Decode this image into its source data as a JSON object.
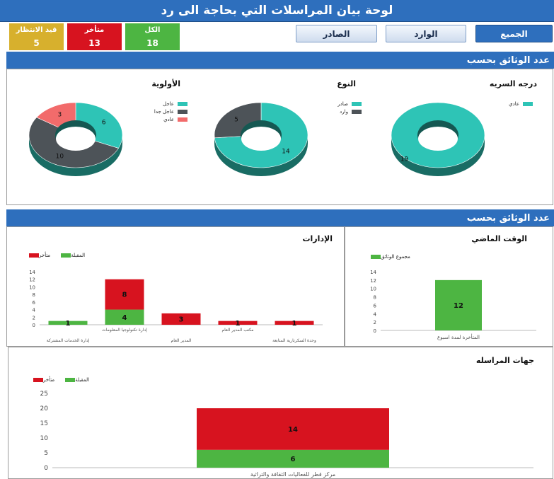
{
  "header": {
    "title": "لوحة بيان المراسلات التي بحاجة الى رد"
  },
  "kpis": [
    {
      "label": "قيد الانتظار",
      "value": "5",
      "color": "#d7b02d"
    },
    {
      "label": "متأخر",
      "value": "13",
      "color": "#d7131f"
    },
    {
      "label": "الكل",
      "value": "18",
      "color": "#4db542"
    }
  ],
  "tabs": [
    {
      "label": "الصادر"
    },
    {
      "label": "الوارد"
    },
    {
      "label": "الجميع"
    }
  ],
  "section1": {
    "title": "عدد الوثائق بحسب"
  },
  "section2": {
    "title": "عدد الوثائق بحسب"
  },
  "colors": {
    "teal": "#2ec4b6",
    "dark": "#4d5358",
    "salmon": "#f26b6b",
    "green": "#4db542",
    "red": "#d7131f",
    "header_blue": "#2e6fbd"
  },
  "chart_data": [
    {
      "type": "pie",
      "title": "الأولوية",
      "labels": [
        "عاجل",
        "عاجل جدا",
        "عادي"
      ],
      "values": [
        6,
        10,
        3
      ],
      "colors": [
        "#2ec4b6",
        "#4d5358",
        "#f26b6b"
      ]
    },
    {
      "type": "pie",
      "title": "النوع",
      "labels": [
        "صادر",
        "وارد"
      ],
      "values": [
        14,
        5
      ],
      "colors": [
        "#2ec4b6",
        "#4d5358"
      ]
    },
    {
      "type": "pie",
      "title": "درجه السريه",
      "labels": [
        "عادي"
      ],
      "values": [
        19
      ],
      "colors": [
        "#2ec4b6"
      ]
    },
    {
      "type": "bar",
      "title": "الإدارات",
      "categories": [
        "إدارة الخدمات المشتركة",
        "إدارة تكنولوجيا المعلومات",
        "المدير العام",
        "مكتب المدير العام",
        "وحدة السكرتارية  المتابعة"
      ],
      "series": [
        {
          "name": "المقبلة",
          "values": [
            1,
            4,
            0,
            0,
            0
          ],
          "color": "#4db542"
        },
        {
          "name": "متأخر",
          "values": [
            0,
            8,
            3,
            1,
            1
          ],
          "color": "#d7131f"
        }
      ],
      "yticks": [
        0,
        2,
        4,
        6,
        8,
        10,
        12,
        14
      ],
      "ylim": [
        0,
        14
      ]
    },
    {
      "type": "bar",
      "title": "الوقت الماضي",
      "categories": [
        "المتأخرة لمدة اسبوع"
      ],
      "series": [
        {
          "name": "مجموع الوثائق",
          "values": [
            12
          ],
          "color": "#4db542"
        }
      ],
      "yticks": [
        0,
        2,
        4,
        6,
        8,
        10,
        12,
        14
      ],
      "ylim": [
        0,
        14
      ]
    },
    {
      "type": "bar",
      "title": "جهات المراسله",
      "categories": [
        "مركز قطر للفعاليات الثقافة والتراثية"
      ],
      "series": [
        {
          "name": "المقبلة",
          "values": [
            6
          ],
          "color": "#4db542"
        },
        {
          "name": "متأخر",
          "values": [
            14
          ],
          "color": "#d7131f"
        }
      ],
      "yticks": [
        0,
        5,
        10,
        15,
        20,
        25
      ],
      "ylim": [
        0,
        25
      ]
    }
  ]
}
